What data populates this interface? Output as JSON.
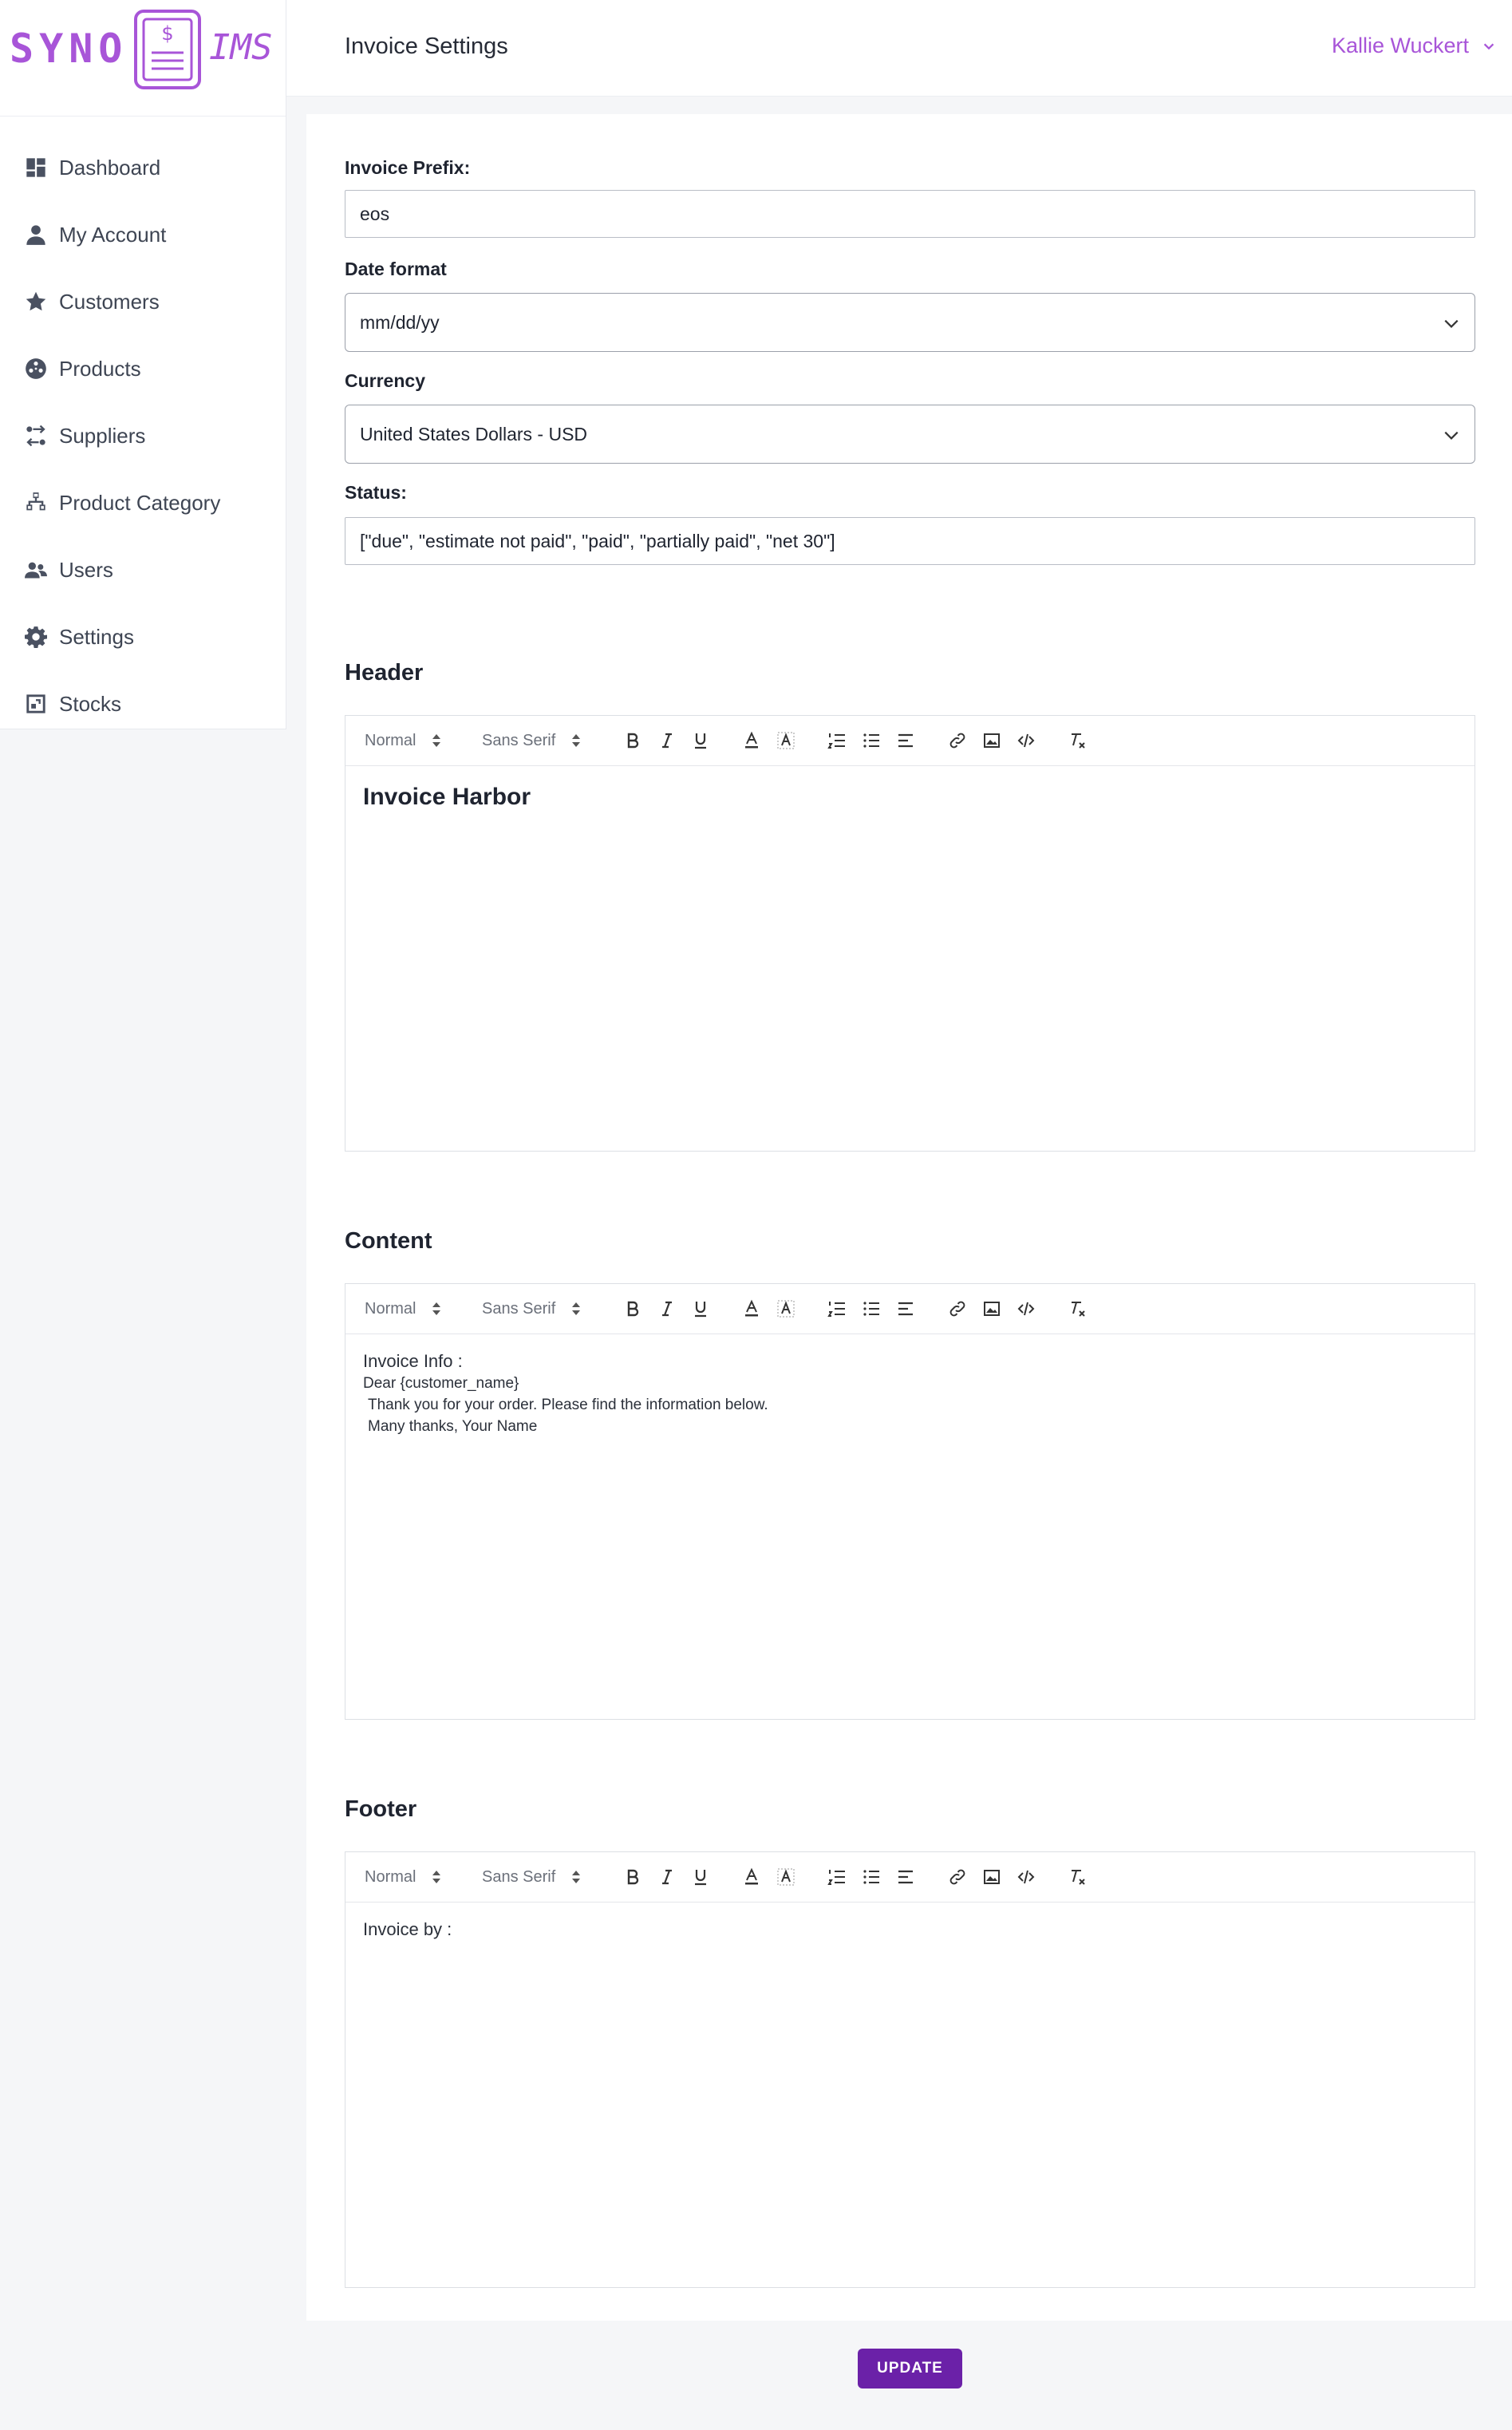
{
  "brand": {
    "left": "SYNO",
    "right": "IMS",
    "accent": "#a855d8"
  },
  "sidebar": {
    "items": [
      {
        "label": "Dashboard",
        "icon": "dashboard-icon"
      },
      {
        "label": "My Account",
        "icon": "user-icon"
      },
      {
        "label": "Customers",
        "icon": "star-icon"
      },
      {
        "label": "Products",
        "icon": "products-icon"
      },
      {
        "label": "Suppliers",
        "icon": "suppliers-icon"
      },
      {
        "label": "Product Category",
        "icon": "sitemap-icon"
      },
      {
        "label": "Users",
        "icon": "users-icon"
      },
      {
        "label": "Settings",
        "icon": "gear-icon"
      },
      {
        "label": "Stocks",
        "icon": "stocks-icon"
      }
    ]
  },
  "header": {
    "title": "Invoice Settings",
    "user_name": "Kallie Wuckert"
  },
  "form": {
    "prefix": {
      "label": "Invoice Prefix:",
      "value": "eos"
    },
    "date_format": {
      "label": "Date format",
      "value": "mm/dd/yy"
    },
    "currency": {
      "label": "Currency",
      "value": "United States Dollars - USD"
    },
    "status": {
      "label": "Status:",
      "value": "[\"due\", \"estimate not paid\", \"paid\", \"partially paid\", \"net 30\"]"
    }
  },
  "toolbar": {
    "size": "Normal",
    "font": "Sans Serif"
  },
  "sections": {
    "header": {
      "title": "Header",
      "content": "Invoice Harbor"
    },
    "content": {
      "title": "Content",
      "lines": [
        "Invoice Info :",
        "Dear {customer_name}",
        "Thank you for your order. Please find the information below.",
        "Many thanks, Your Name"
      ]
    },
    "footer": {
      "title": "Footer",
      "content": "Invoice by :"
    }
  },
  "update_button": {
    "label": "UPDATE",
    "color": "#6b21a8"
  }
}
